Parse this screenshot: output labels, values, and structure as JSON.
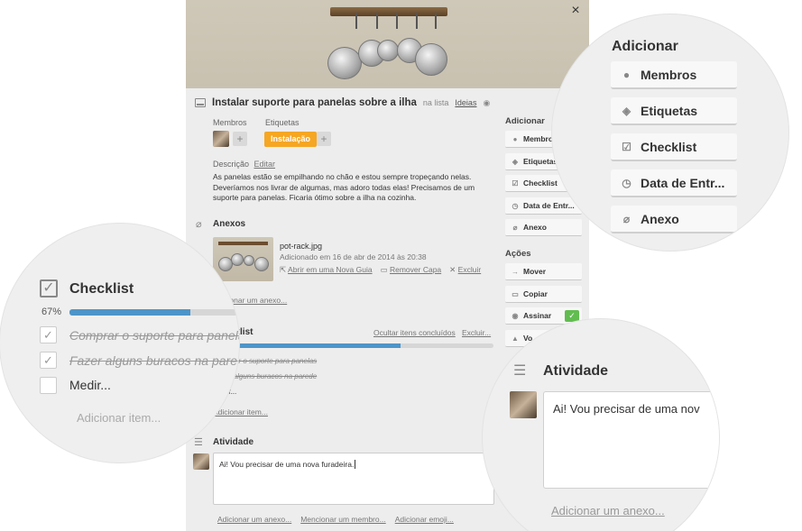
{
  "card": {
    "title": "Instalar suporte para panelas sobre a ilha",
    "in_list_prefix": "na lista",
    "list_name": "Ideias",
    "members_label": "Membros",
    "labels_label": "Etiquetas",
    "label_tag": "Instalação",
    "label_color": "#f5a623",
    "add_symbol": "+",
    "description_label": "Descrição",
    "description_edit": "Editar",
    "description_text": "As panelas estão se empilhando no chão e estou sempre tropeçando nelas. Deveríamos nos livrar de algumas, mas adoro todas elas! Precisamos de um suporte para panelas. Ficaria ótimo sobre a ilha na cozinha.",
    "close_symbol": "×"
  },
  "attachments": {
    "heading": "Anexos",
    "file_name": "pot-rack.jpg",
    "added_text": "Adicionado em 16 de abr de 2014 às 20:38",
    "open_link": "Abrir em uma Nova Guia",
    "remove_cover_link": "Remover Capa",
    "delete_link": "Excluir",
    "add_attachment": "Adicionar um anexo..."
  },
  "checklist": {
    "heading": "Checklist",
    "hide_completed": "Ocultar itens concluídos",
    "delete_link": "Excluir...",
    "percent": "67%",
    "progress": 0.67,
    "progress_color": "#4d95c9",
    "items": [
      {
        "text": "Comprar o suporte para panelas",
        "done": true
      },
      {
        "text": "Fazer alguns buracos na parede",
        "done": true
      },
      {
        "text": "Medir...",
        "done": false
      }
    ],
    "add_item": "Adicionar item..."
  },
  "activity": {
    "heading": "Atividade",
    "comment_text": "Ai! Vou precisar de uma nova furadeira.",
    "add_attachment": "Adicionar um anexo...",
    "mention_member": "Mencionar um membro...",
    "add_emoji": "Adicionar emoji..."
  },
  "sidebar": {
    "add_heading": "Adicionar",
    "add_buttons": [
      {
        "label": "Membros",
        "icon": "person-icon"
      },
      {
        "label": "Etiquetas",
        "icon": "tag-icon"
      },
      {
        "label": "Checklist",
        "icon": "checkbox-icon"
      },
      {
        "label": "Data de Entr...",
        "icon": "clock-icon"
      },
      {
        "label": "Anexo",
        "icon": "paperclip-icon"
      }
    ],
    "actions_heading": "Ações",
    "action_buttons": [
      {
        "label": "Mover",
        "icon": "arrow-right-icon"
      },
      {
        "label": "Copiar",
        "icon": "card-icon"
      },
      {
        "label": "Assinar",
        "icon": "eye-icon"
      },
      {
        "label": "Vo",
        "icon": "thumbs-up-icon"
      }
    ],
    "subscribe_check": "✓",
    "check_color": "#61bd4f"
  },
  "zoom_add": {
    "heading": "Adicionar",
    "buttons": [
      {
        "label": "Membros",
        "icon": "person-icon"
      },
      {
        "label": "Etiquetas",
        "icon": "tag-icon"
      },
      {
        "label": "Checklist",
        "icon": "checkbox-icon"
      },
      {
        "label": "Data de Entr...",
        "icon": "clock-icon"
      },
      {
        "label": "Anexo",
        "icon": "paperclip-icon"
      }
    ]
  },
  "zoom_checklist": {
    "heading": "Checklist",
    "percent": "67%",
    "items": [
      {
        "text": "Comprar o suporte para panelas"
      },
      {
        "text": "Fazer alguns buracos na parede"
      },
      {
        "text": "Medir..."
      }
    ],
    "add_item": "Adicionar item..."
  },
  "zoom_activity": {
    "heading": "Atividade",
    "comment_text": "Ai! Vou precisar de uma nov",
    "add_attachment": "Adicionar um anexo..."
  }
}
